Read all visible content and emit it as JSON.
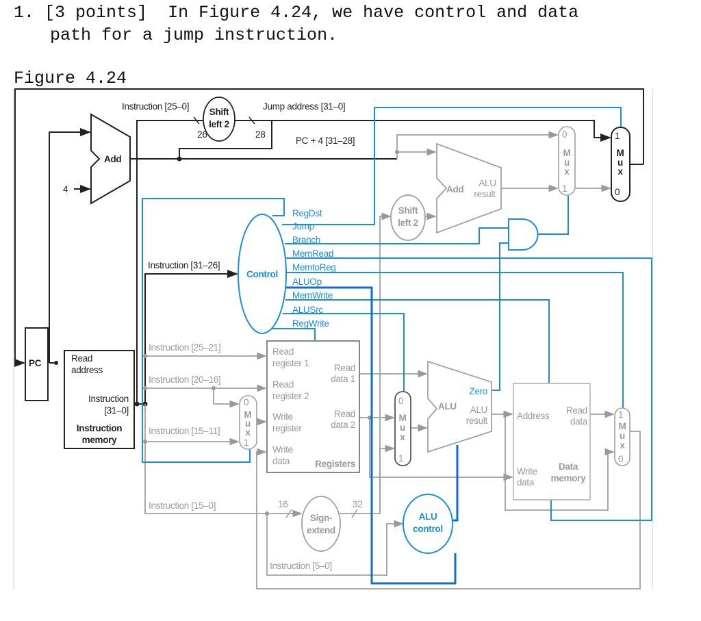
{
  "question": {
    "number": "1.",
    "points": "[3 points]",
    "line1": "In Figure 4.24, we have control and data",
    "line2": "path for a jump instruction."
  },
  "figure_caption": "Figure 4.24",
  "diagram": {
    "instruction_25_0": "Instruction [25–0]",
    "shift_left_2_top": [
      "Shift",
      "left 2"
    ],
    "bits_26": "26",
    "bits_28": "28",
    "jump_address": "Jump address [31–0]",
    "pc4_31_28": "PC + 4 [31–28]",
    "add_pc": "Add",
    "four": "4",
    "add_branch": "Add",
    "alu_result_top": [
      "ALU",
      "result"
    ],
    "shift_left_2_branch": [
      "Shift",
      "left 2"
    ],
    "mux_labels": [
      "M",
      "u",
      "x"
    ],
    "mux_in0": "0",
    "mux_in1": "1",
    "control": "Control",
    "control_signals": [
      "RegDst",
      "Jump",
      "Branch",
      "MemRead",
      "MemtoReg",
      "ALUOp",
      "MemWrite",
      "ALUSrc",
      "RegWrite"
    ],
    "instruction_31_26": "Instruction [31–26]",
    "pc": "PC",
    "imem": {
      "read_address": [
        "Read",
        "address"
      ],
      "instruction": [
        "Instruction",
        "[31–0]"
      ],
      "name": [
        "Instruction",
        "memory"
      ]
    },
    "instruction_25_21": "Instruction [25–21]",
    "instruction_20_16": "Instruction [20–16]",
    "instruction_15_11": "Instruction [15–11]",
    "instruction_15_0": "Instruction [15–0]",
    "instruction_5_0": "Instruction [5–0]",
    "registers": {
      "read_register_1": [
        "Read",
        "register 1"
      ],
      "read_register_2": [
        "Read",
        "register 2"
      ],
      "write_register": [
        "Write",
        "register"
      ],
      "write_data": [
        "Write",
        "data"
      ],
      "read_data_1": [
        "Read",
        "data 1"
      ],
      "read_data_2": [
        "Read",
        "data 2"
      ],
      "name": "Registers"
    },
    "alu": "ALU",
    "zero": "Zero",
    "alu_result": [
      "ALU",
      "result"
    ],
    "dmem": {
      "address": "Address",
      "read_data": [
        "Read",
        "data"
      ],
      "write_data": [
        "Write",
        "data"
      ],
      "name": [
        "Data",
        "memory"
      ]
    },
    "sign_extend": [
      "Sign-",
      "extend"
    ],
    "bits_16": "16",
    "bits_32": "32",
    "alu_control": [
      "ALU",
      "control"
    ]
  },
  "colors": {
    "control_blue": "#1a8fd8",
    "aluop_blue": "#0b6ed0",
    "active_black": "#222222",
    "inactive_gray": "#a0a0a0"
  }
}
